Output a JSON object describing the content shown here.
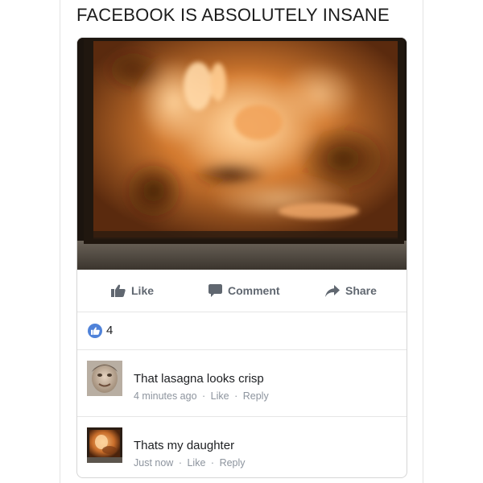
{
  "meme": {
    "title": "FACEBOOK IS ABSOLUTELY INSANE"
  },
  "post": {
    "actions": {
      "like_label": "Like",
      "comment_label": "Comment",
      "share_label": "Share"
    },
    "reactions": {
      "icon": "thumbs-up-icon",
      "count": "4"
    },
    "comments": [
      {
        "text": "That lasagna looks crisp",
        "time": "4 minutes ago",
        "like_label": "Like",
        "reply_label": "Reply",
        "separator": "·"
      },
      {
        "text": "Thats my daughter",
        "time": "Just now",
        "like_label": "Like",
        "reply_label": "Reply",
        "separator": "·"
      }
    ]
  },
  "colors": {
    "action_gray": "#606770",
    "meta_gray": "#8d949e",
    "reaction_blue": "#4f82d9"
  }
}
